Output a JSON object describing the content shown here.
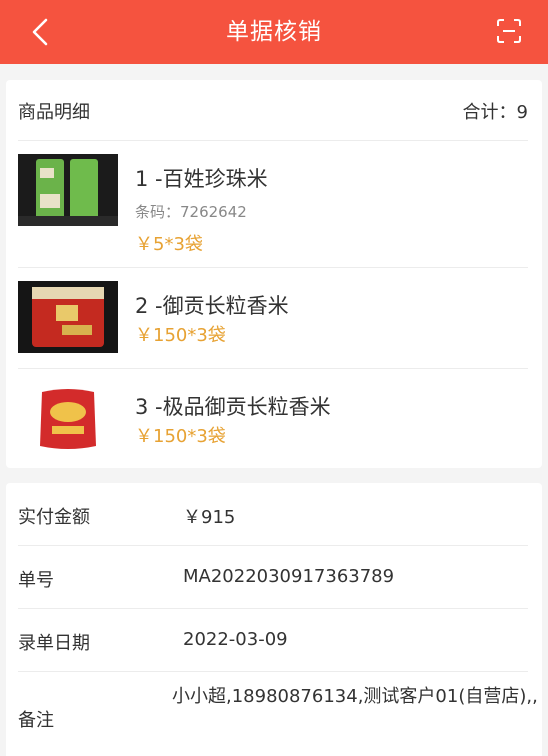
{
  "header": {
    "title": "单据核销",
    "back_icon": "chevron-left-icon",
    "scan_icon": "scan-icon",
    "bg_color": "#f5533f"
  },
  "goods": {
    "section_label": "商品明细",
    "total_label": "合计：9",
    "items": [
      {
        "name": "1 -百姓珍珠米",
        "code_label": "条码：7262642",
        "price": "￥5*3袋"
      },
      {
        "name": "2 -御贡长粒香米",
        "price": "￥150*3袋"
      },
      {
        "name": "3 -极品御贡长粒香米",
        "price": "￥150*3袋"
      }
    ]
  },
  "details": {
    "rows": [
      {
        "label": "实付金额",
        "value": "￥915"
      },
      {
        "label": "单号",
        "value": "MA2022030917363789"
      },
      {
        "label": "录单日期",
        "value": "2022-03-09"
      },
      {
        "label": "备注",
        "value": "小小超,18980876134,测试客户01(自营店),,"
      }
    ]
  },
  "colors": {
    "price": "#e7a233",
    "accent": "#f5533f"
  }
}
